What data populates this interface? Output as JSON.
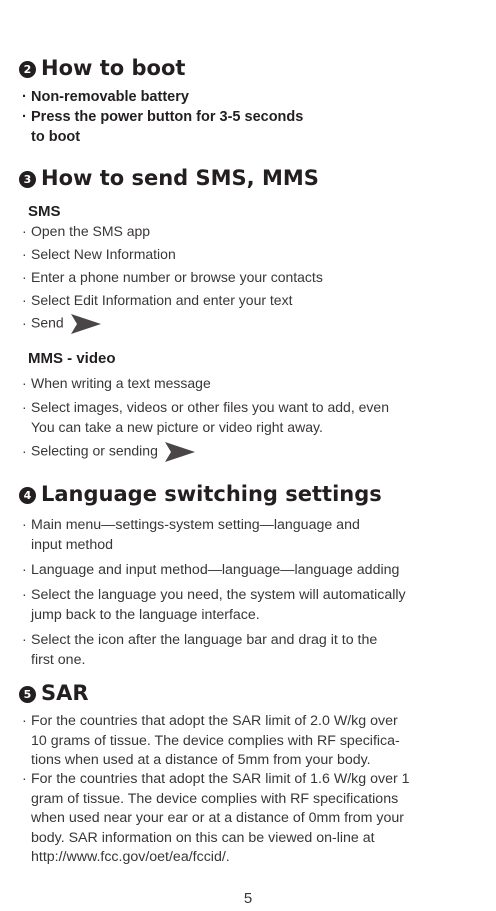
{
  "boot": {
    "number": "2",
    "title": "How to boot",
    "items": [
      "Non-removable battery",
      "Press the power button for 3-5 seconds",
      "to boot"
    ]
  },
  "sms": {
    "number": "3",
    "title": "How to send SMS, MMS",
    "sms_heading": "SMS",
    "sms_items": [
      "Open the SMS app",
      "Select New Information",
      "Enter a phone number or browse your contacts",
      "Select Edit Information and enter your text",
      "Send"
    ],
    "mms_heading": "MMS - video",
    "mms_items": [
      "When writing a text message",
      "Select images, videos or other files you want to add, even",
      "You can take a new picture or video right away.",
      "Selecting or sending"
    ],
    "send_icon": "send-arrow-icon"
  },
  "language": {
    "number": "4",
    "title": "Language switching settings",
    "items": [
      [
        "Main menu—settings-system setting—language and",
        "input method"
      ],
      [
        "Language and input method—language—language adding"
      ],
      [
        "Select the language you need, the system will automatically",
        "jump back to the language interface."
      ],
      [
        "Select the icon after the language bar and drag it to the",
        "first one."
      ]
    ]
  },
  "sar": {
    "number": "5",
    "title": "SAR",
    "items": [
      [
        "For the countries that adopt the SAR limit of 2.0 W/kg over",
        "10 grams of tissue. The device complies with RF specifica-",
        "tions when used at a distance of 5mm from your body."
      ],
      [
        "For the countries that adopt the SAR limit of 1.6 W/kg over 1",
        "gram of tissue. The device complies with RF specifications",
        "when used near your ear or at a distance of 0mm from your",
        "body. SAR information on this can be viewed on-line at",
        "http://www.fcc.gov/oet/ea/fccid/."
      ]
    ]
  },
  "page_number": "5",
  "colors": {
    "text": "#231f20",
    "body_text": "#3a3637",
    "icon": "#4a4647"
  }
}
